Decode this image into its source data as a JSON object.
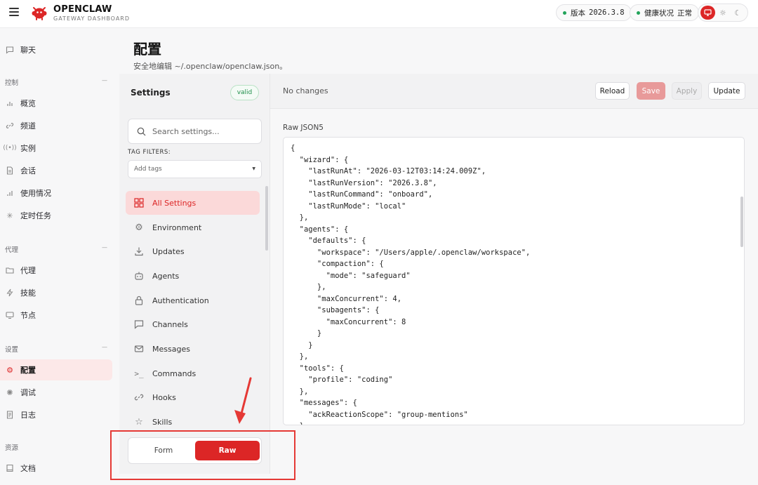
{
  "header": {
    "brand_title": "OPENCLAW",
    "brand_subtitle": "GATEWAY DASHBOARD",
    "version_label": "版本",
    "version_value": "2026.3.8",
    "health_label": "健康状况",
    "health_value": "正常",
    "status_color": "#22a35a",
    "accent_color": "#dc2626"
  },
  "sidebar": {
    "chat": "聊天",
    "sections": {
      "control": "控制",
      "agent": "代理",
      "settings": "设置",
      "resources": "资源"
    },
    "control_items": [
      "概览",
      "频道",
      "实例",
      "会话",
      "使用情况",
      "定时任务"
    ],
    "agent_items": [
      "代理",
      "技能",
      "节点"
    ],
    "settings_items": [
      "配置",
      "调试",
      "日志"
    ],
    "resource_items": [
      "文档"
    ]
  },
  "page": {
    "title": "配置",
    "subtitle": "安全地编辑 ~/.openclaw/openclaw.json。"
  },
  "settings_panel": {
    "title": "Settings",
    "status_badge": "valid",
    "search_placeholder": "Search settings...",
    "tag_filters_label": "TAG FILTERS:",
    "tag_placeholder": "Add tags",
    "items": [
      "All Settings",
      "Environment",
      "Updates",
      "Agents",
      "Authentication",
      "Channels",
      "Messages",
      "Commands",
      "Hooks",
      "Skills"
    ],
    "mode_form": "Form",
    "mode_raw": "Raw"
  },
  "editor": {
    "status": "No changes",
    "reload": "Reload",
    "save": "Save",
    "apply": "Apply",
    "update": "Update",
    "raw_label": "Raw JSON5",
    "code": "{\n  \"wizard\": {\n    \"lastRunAt\": \"2026-03-12T03:14:24.009Z\",\n    \"lastRunVersion\": \"2026.3.8\",\n    \"lastRunCommand\": \"onboard\",\n    \"lastRunMode\": \"local\"\n  },\n  \"agents\": {\n    \"defaults\": {\n      \"workspace\": \"/Users/apple/.openclaw/workspace\",\n      \"compaction\": {\n        \"mode\": \"safeguard\"\n      },\n      \"maxConcurrent\": 4,\n      \"subagents\": {\n        \"maxConcurrent\": 8\n      }\n    }\n  },\n  \"tools\": {\n    \"profile\": \"coding\"\n  },\n  \"messages\": {\n    \"ackReactionScope\": \"group-mentions\"\n  },"
  }
}
